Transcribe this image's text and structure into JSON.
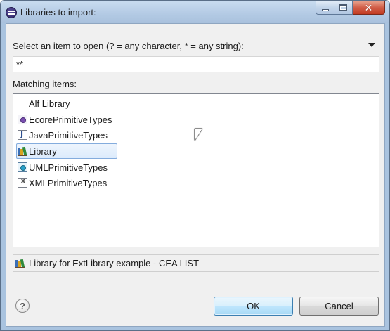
{
  "window": {
    "title": "Libraries to import:",
    "controls": [
      "minimize-icon",
      "maximize-icon",
      "close-icon"
    ]
  },
  "filter": {
    "prompt": "Select an item to open (? = any character, * = any string):",
    "value": "**"
  },
  "list": {
    "label": "Matching items:",
    "items": [
      {
        "label": "Alf Library",
        "icon": "none",
        "selected": false
      },
      {
        "label": "EcorePrimitiveTypes",
        "icon": "ecore-package-icon",
        "selected": false
      },
      {
        "label": "JavaPrimitiveTypes",
        "icon": "java-file-icon",
        "selected": false
      },
      {
        "label": "Library",
        "icon": "library-books-icon",
        "selected": true
      },
      {
        "label": "UMLPrimitiveTypes",
        "icon": "uml-package-icon",
        "selected": false
      },
      {
        "label": "XMLPrimitiveTypes",
        "icon": "xml-file-icon",
        "selected": false
      }
    ]
  },
  "status": {
    "text": "Library for ExtLibrary example - CEA LIST",
    "icon": "library-books-icon"
  },
  "buttons": {
    "help": "?",
    "ok": "OK",
    "cancel": "Cancel"
  },
  "colors": {
    "titlebar": "#b3cae4",
    "selection": "#dcebfc",
    "close": "#c23b22"
  }
}
